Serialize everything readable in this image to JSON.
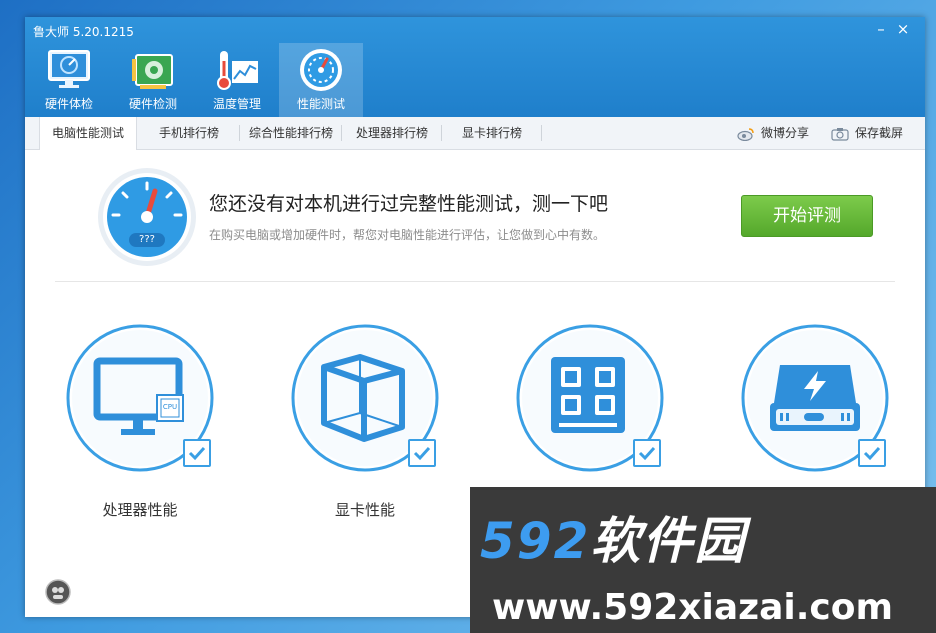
{
  "app": {
    "title": "鲁大师 5.20.1215",
    "minimize": "–",
    "close": "×"
  },
  "nav": [
    {
      "label": "硬件体检",
      "icon": "monitor-icon"
    },
    {
      "label": "硬件检测",
      "icon": "circuit-board-icon"
    },
    {
      "label": "温度管理",
      "icon": "thermometer-icon"
    },
    {
      "label": "性能测试",
      "icon": "speedometer-icon",
      "active": true
    }
  ],
  "tabs": [
    "电脑性能测试",
    "手机排行榜",
    "综合性能排行榜",
    "处理器排行榜",
    "显卡排行榜"
  ],
  "tools": {
    "share": "微博分享",
    "screenshot": "保存截屏"
  },
  "hero": {
    "gauge_text": "???",
    "heading": "您还没有对本机进行过完整性能测试，测一下吧",
    "sub": "在购买电脑或增加硬件时，帮您对电脑性能进行评估，让您做到心中有数。",
    "button": "开始评测"
  },
  "cards": [
    {
      "label": "处理器性能",
      "icon": "cpu-monitor-icon",
      "badge": "CPU"
    },
    {
      "label": "显卡性能",
      "icon": "cube-icon"
    },
    {
      "label": "",
      "icon": "memory-chip-icon"
    },
    {
      "label": "",
      "icon": "disk-drive-icon"
    }
  ],
  "watermark": {
    "num": "592",
    "cn": "软件园",
    "url": "www.592xiazai.com"
  },
  "colors": {
    "accent": "#2a8fd8",
    "button": "#5fb232"
  }
}
